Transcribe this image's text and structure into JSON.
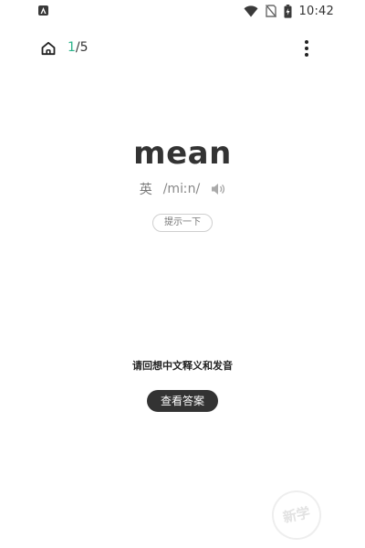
{
  "status_bar": {
    "time": "10:42",
    "icons": [
      "app-notification-icon",
      "wifi-icon",
      "no-sim-icon",
      "battery-charging-icon"
    ]
  },
  "nav": {
    "home_icon": "home-icon",
    "progress_current": "1",
    "progress_total": "/5",
    "more_icon": "more-vertical-icon"
  },
  "word": {
    "text": "mean",
    "accent_label": "英",
    "phonetic": "/miːn/",
    "speaker_icon": "speaker-icon"
  },
  "hint_button_label": "提示一下",
  "prompt_text": "请回想中文释义和发音",
  "answer_button_label": "查看答案",
  "watermark_text": "新学",
  "colors": {
    "accent_green": "#2bb38a",
    "button_dark": "#333333",
    "text_gray": "#888888"
  }
}
